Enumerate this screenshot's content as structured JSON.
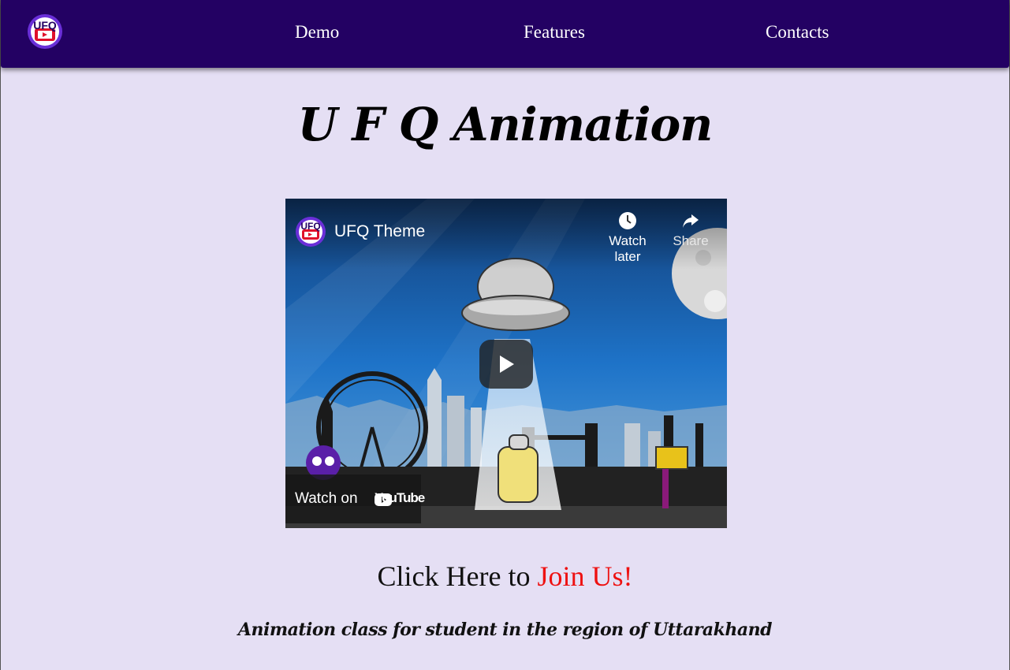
{
  "nav": {
    "logo_text": "UFQ",
    "links": [
      "Demo",
      "Features",
      "Contacts"
    ]
  },
  "main": {
    "title": "U F Q Animation",
    "cta_prefix": "Click Here to ",
    "cta_link": "Join Us!",
    "tagline": "Animation class for student in the region of Uttarakhand"
  },
  "video": {
    "title": "UFQ Theme",
    "channel_avatar_text": "UFQ",
    "watch_later": "Watch later",
    "share": "Share",
    "watch_on": "Watch on",
    "youtube": "YouTube",
    "icons": [
      "play-icon",
      "clock-icon",
      "share-arrow-icon",
      "youtube-icon"
    ]
  },
  "colors": {
    "navbar": "#230163",
    "background": "#e5dff4",
    "accent": "#ee1111"
  }
}
